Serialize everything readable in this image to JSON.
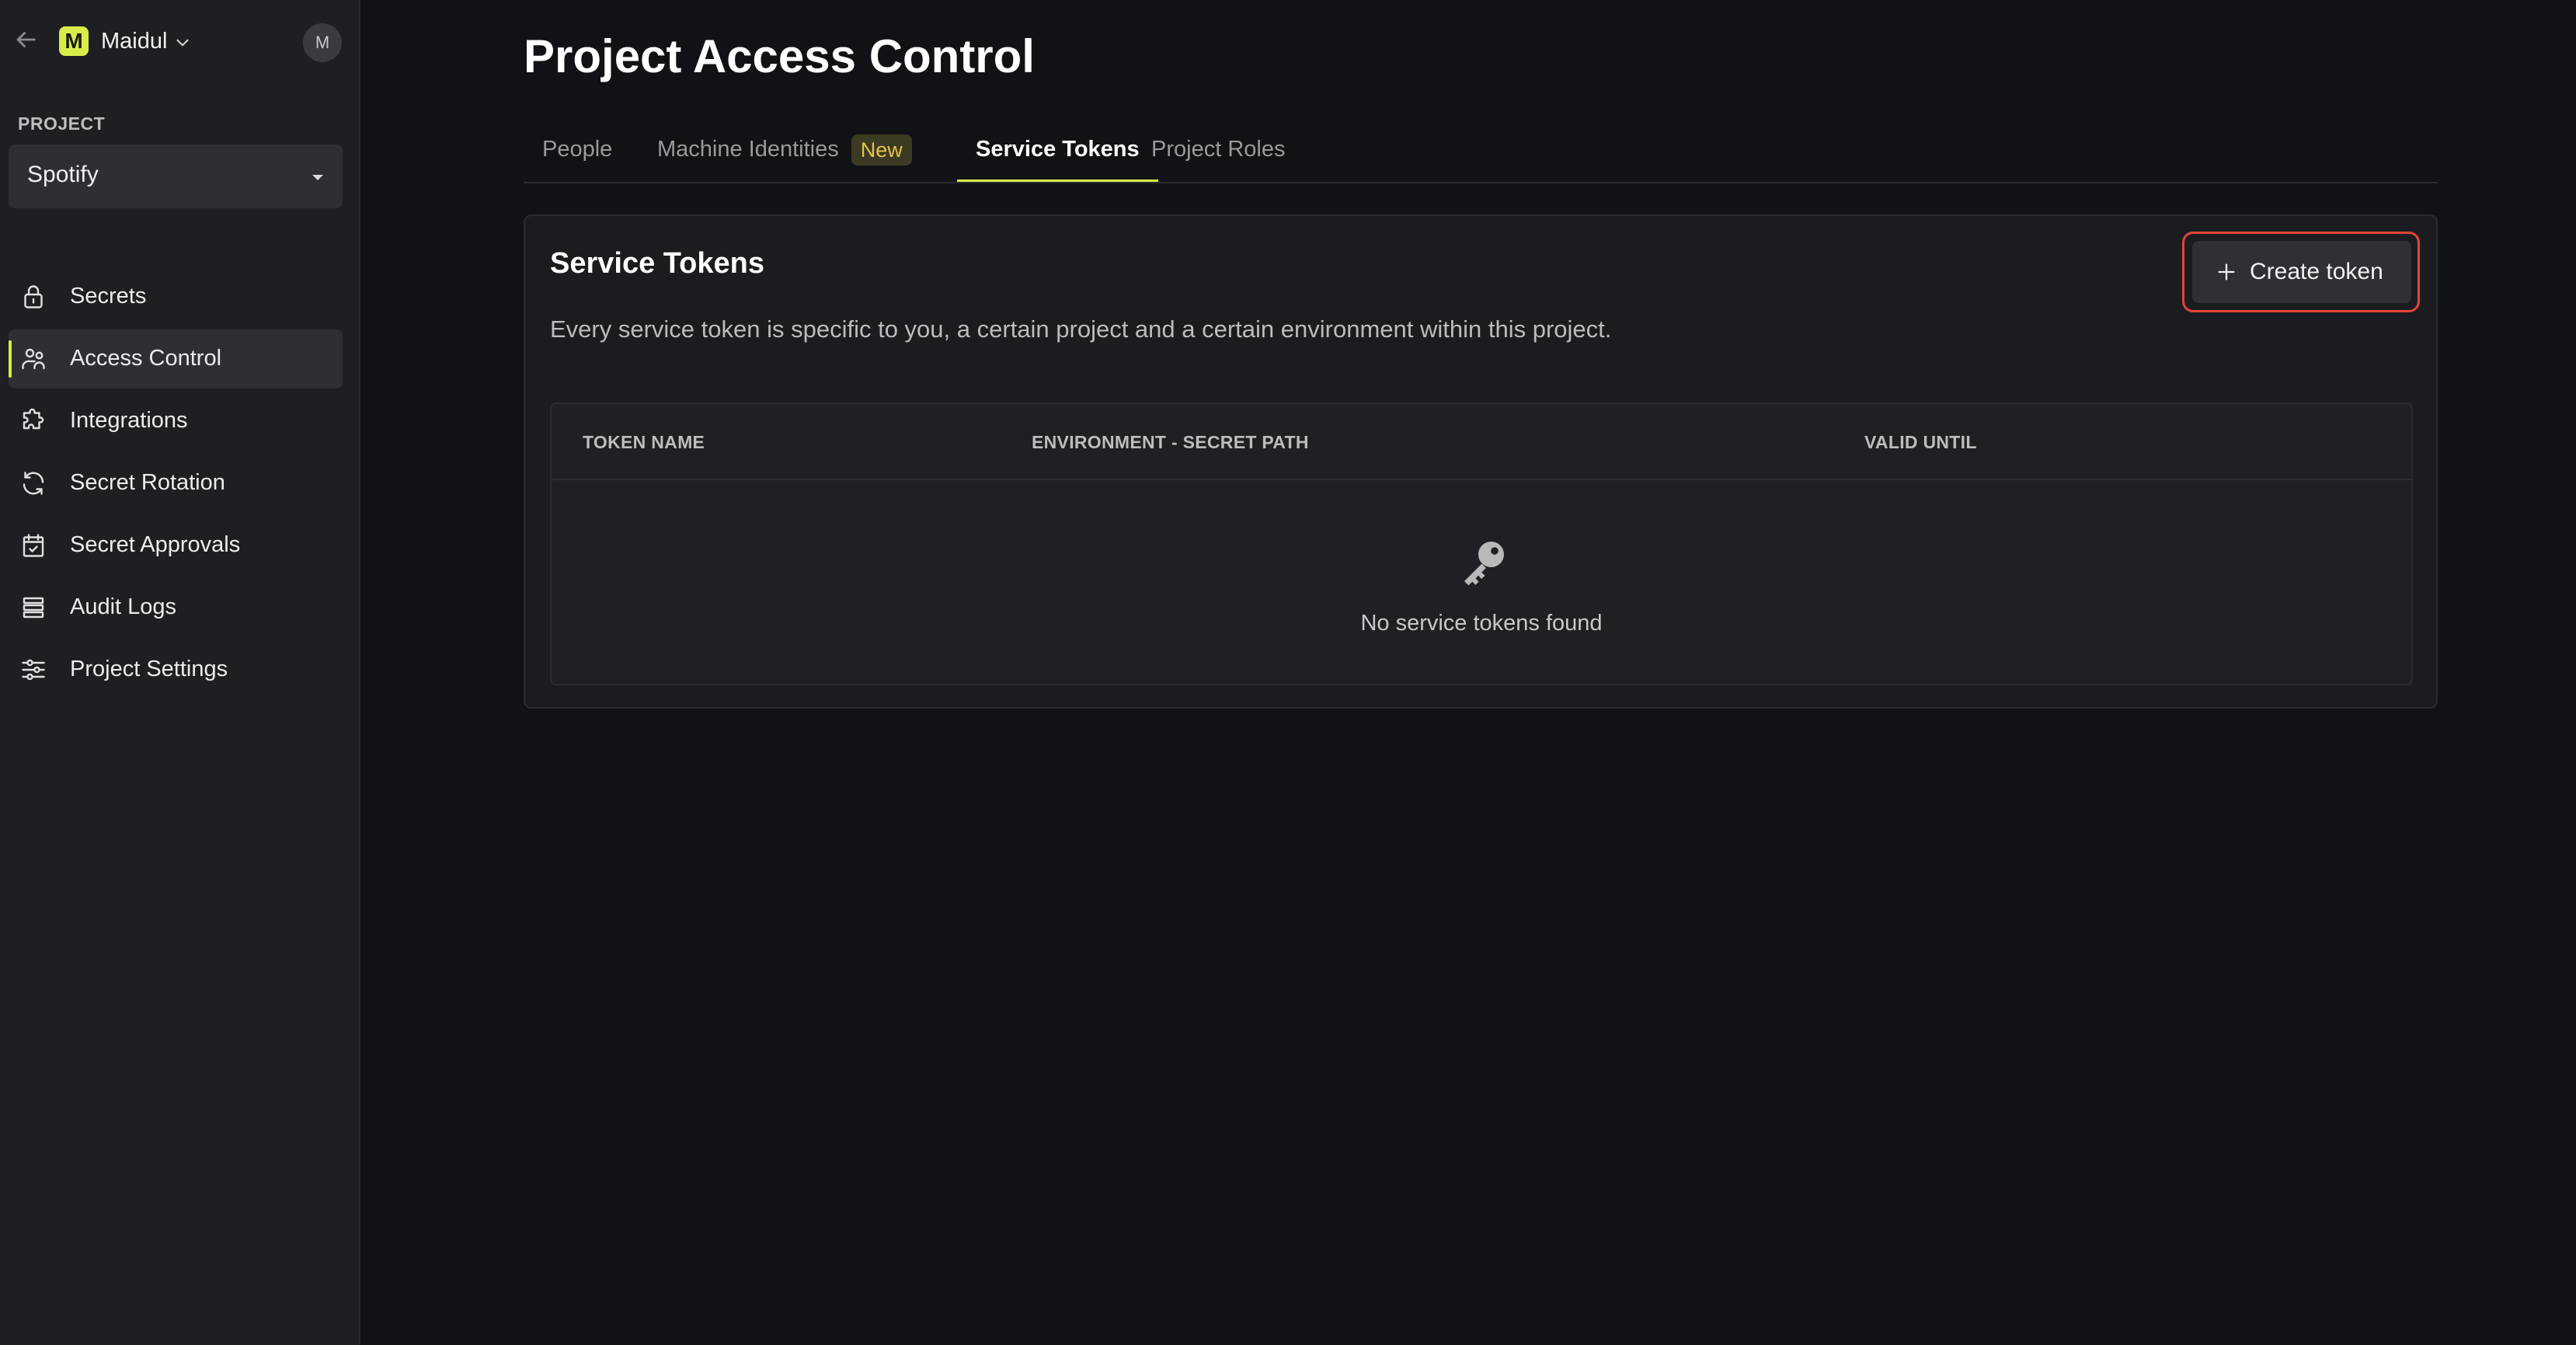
{
  "sidebar": {
    "org": {
      "initial": "M",
      "name": "Maidul"
    },
    "user_initial": "M",
    "project_label": "PROJECT",
    "project_selected": "Spotify",
    "items": [
      {
        "label": "Secrets",
        "icon": "lock-icon"
      },
      {
        "label": "Access Control",
        "icon": "users-icon",
        "active": true
      },
      {
        "label": "Integrations",
        "icon": "puzzle-icon"
      },
      {
        "label": "Secret Rotation",
        "icon": "rotate-icon"
      },
      {
        "label": "Secret Approvals",
        "icon": "calendar-check-icon"
      },
      {
        "label": "Audit Logs",
        "icon": "list-icon"
      },
      {
        "label": "Project Settings",
        "icon": "sliders-icon"
      }
    ]
  },
  "main": {
    "title": "Project Access Control",
    "tabs": [
      {
        "label": "People"
      },
      {
        "label": "Machine Identities",
        "badge": "New"
      },
      {
        "label": "Service Tokens",
        "active": true
      },
      {
        "label": "Project Roles"
      }
    ],
    "card": {
      "title": "Service Tokens",
      "description": "Every service token is specific to you, a certain project and a certain environment within this project.",
      "create_button": "Create token",
      "table": {
        "columns": [
          "TOKEN NAME",
          "ENVIRONMENT - SECRET PATH",
          "VALID UNTIL"
        ],
        "empty_text": "No service tokens found",
        "empty_icon": "key-icon"
      }
    }
  },
  "colors": {
    "accent": "#d8ec4a",
    "highlight_outline": "#e04638",
    "background": "#111216",
    "sidebar": "#1e1f23"
  }
}
